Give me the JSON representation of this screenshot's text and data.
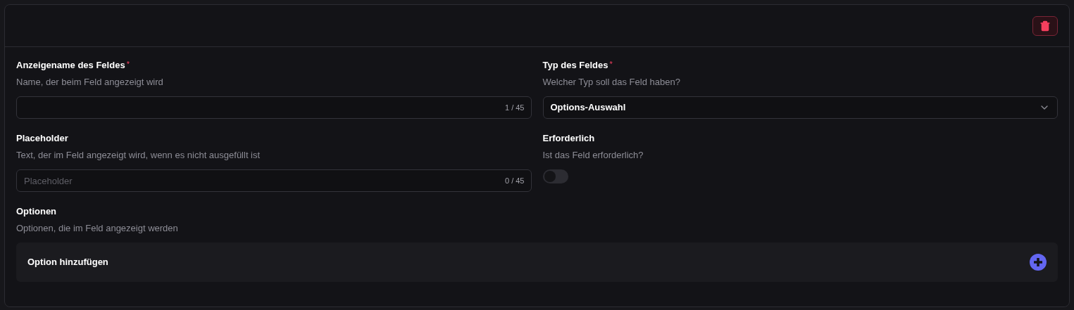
{
  "fields": [
    {
      "kind": "text",
      "label": "Anzeigename des Feldes",
      "required_mark": "*",
      "description": "Name, der beim Feld angezeigt wird",
      "counter": "1 / 45"
    },
    {
      "kind": "select",
      "label": "Typ des Feldes",
      "required_mark": "*",
      "description": "Welcher Typ soll das Feld haben?",
      "value": "Options-Auswahl"
    },
    {
      "kind": "text",
      "label": "Placeholder",
      "description": "Text, der im Feld angezeigt wird, wenn es nicht ausgefüllt ist",
      "placeholder": "Placeholder",
      "counter": "0 / 45"
    },
    {
      "kind": "toggle",
      "label": "Erforderlich",
      "description": "Ist das Feld erforderlich?",
      "on": false
    }
  ],
  "options": {
    "label": "Optionen",
    "description": "Optionen, die im Feld angezeigt werden",
    "add_label": "Option hinzufügen"
  }
}
